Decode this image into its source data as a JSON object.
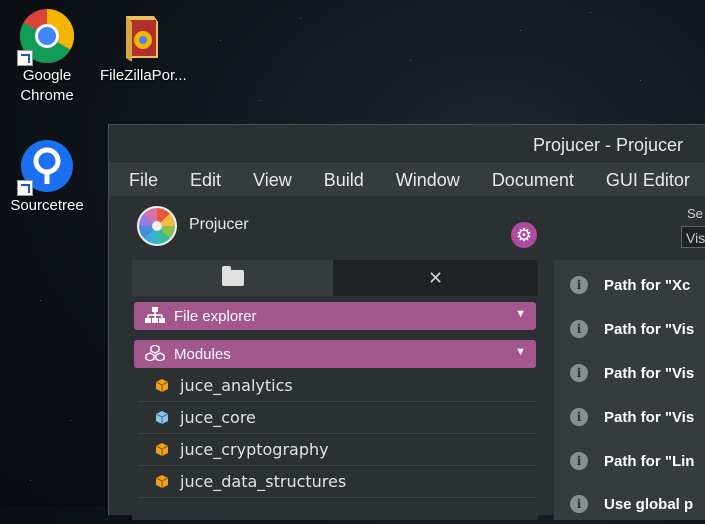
{
  "desktop": {
    "icons": [
      {
        "label_line1": "Google",
        "label_line2": "Chrome"
      },
      {
        "label_line1": "FileZillaPor..."
      },
      {
        "label_line1": "Sourcetree"
      }
    ]
  },
  "window": {
    "title": "Projucer - Projucer",
    "menu": [
      "File",
      "Edit",
      "View",
      "Build",
      "Window",
      "Document",
      "GUI Editor"
    ],
    "project_name": "Projucer",
    "selector_label": "Se",
    "selector_value": "Vis",
    "tabs": [
      {
        "icon": "folder-icon"
      },
      {
        "icon": "tools-icon"
      }
    ],
    "sections": [
      {
        "label": "File explorer",
        "icon": "hierarchy-icon"
      },
      {
        "label": "Modules",
        "icon": "modules-icon"
      }
    ],
    "modules": [
      {
        "name": "juce_analytics",
        "color": "#f0a020"
      },
      {
        "name": "juce_core",
        "color": "#8fc4e8"
      },
      {
        "name": "juce_cryptography",
        "color": "#f0a020"
      },
      {
        "name": "juce_data_structures",
        "color": "#f0a020"
      }
    ],
    "settings_rows": [
      {
        "text": "Path for \"Xc"
      },
      {
        "text": "Path for \"Vis"
      },
      {
        "text": "Path for \"Vis"
      },
      {
        "text": "Path for \"Vis"
      },
      {
        "text": "Path for \"Lin"
      },
      {
        "text": "Use global p"
      }
    ]
  },
  "colors": {
    "section_bg": "#a4578f",
    "gear_bg": "#b04ca0",
    "window_bg": "#2b3033"
  }
}
